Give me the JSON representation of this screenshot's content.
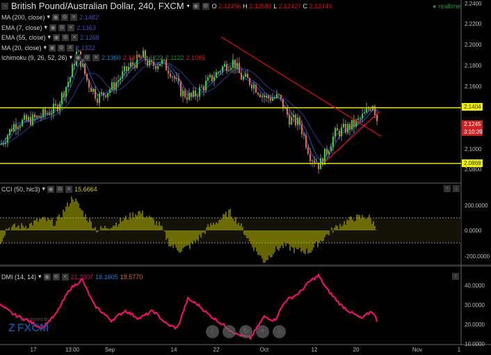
{
  "header": {
    "symbol": "British Pound/Australian Dollar, 240, FXCM",
    "o_label": "O",
    "o": "2.12456",
    "h_label": "H",
    "h": "2.12583",
    "l_label": "L",
    "l": "2.12427",
    "c_label": "C",
    "c": "2.12449",
    "status": "realtime"
  },
  "indicators": [
    {
      "label": "MA (200, close)",
      "value": "2.1482",
      "color": "#3040a0"
    },
    {
      "label": "EMA (7, close)",
      "value": "2.1363",
      "color": "#3050a0"
    },
    {
      "label": "EMA (55, close)",
      "value": "2.1268",
      "color": "#3050a0"
    },
    {
      "label": "MA (20, close)",
      "value": "2.1322",
      "color": "#3050a0"
    },
    {
      "label": "Ichimoku (9, 26, 52, 26)",
      "values": [
        "2.1360",
        "2.1371",
        "2.1222",
        "2.1122",
        "2.1085"
      ]
    }
  ],
  "price_axis": [
    "2.2400",
    "2.2200",
    "2.2000",
    "2.1800",
    "2.1600",
    "2.1000",
    "2.0800"
  ],
  "tags": {
    "resistance": "2.1404",
    "support": "2.0869",
    "last": "2.1245",
    "countdown": "3:10:39"
  },
  "cci": {
    "label": "CCI (50, hlc3)",
    "value": "15.6664",
    "axis": [
      "200.0000",
      "0.0000",
      "-200.0000"
    ]
  },
  "dmi": {
    "label": "DMI (14, 14)",
    "values": [
      "21.2007",
      "18.1605",
      "19.5770"
    ],
    "axis": [
      "40.0000",
      "30.0000",
      "20.0000",
      "10.0000"
    ]
  },
  "x_axis": [
    "17",
    "13:00",
    "Sep",
    "14",
    "22",
    "Oct",
    "12",
    "20",
    "Nov",
    "1"
  ],
  "sponsor": {
    "text": "Sponsored by",
    "brand": "FXCM"
  },
  "colors": {
    "up": "#22dd22",
    "down": "#e86840",
    "level": "#e0e000",
    "trend": "#e01010",
    "dmi": "#ff1070",
    "cci": "#c8c800"
  },
  "chart_data": [
    {
      "type": "candlestick",
      "title": "British Pound/Australian Dollar, 240, FXCM",
      "ylim": [
        2.08,
        2.24
      ],
      "close_path": [
        [
          0,
          2.105
        ],
        [
          20,
          2.125
        ],
        [
          50,
          2.13
        ],
        [
          80,
          2.14
        ],
        [
          100,
          2.17
        ],
        [
          110,
          2.195
        ],
        [
          125,
          2.165
        ],
        [
          140,
          2.15
        ],
        [
          160,
          2.16
        ],
        [
          185,
          2.18
        ],
        [
          205,
          2.19
        ],
        [
          215,
          2.18
        ],
        [
          230,
          2.185
        ],
        [
          245,
          2.175
        ],
        [
          260,
          2.155
        ],
        [
          275,
          2.15
        ],
        [
          290,
          2.16
        ],
        [
          305,
          2.17
        ],
        [
          320,
          2.18
        ],
        [
          335,
          2.185
        ],
        [
          345,
          2.17
        ],
        [
          360,
          2.165
        ],
        [
          380,
          2.15
        ],
        [
          400,
          2.15
        ],
        [
          415,
          2.13
        ],
        [
          430,
          2.125
        ],
        [
          445,
          2.095
        ],
        [
          458,
          2.085
        ],
        [
          470,
          2.1
        ],
        [
          480,
          2.115
        ],
        [
          495,
          2.12
        ],
        [
          510,
          2.125
        ],
        [
          525,
          2.135
        ],
        [
          535,
          2.145
        ],
        [
          543,
          2.1245
        ]
      ],
      "levels": [
        2.1404,
        2.0869
      ]
    },
    {
      "type": "bar",
      "title": "CCI (50, hlc3)",
      "ylim": [
        -300,
        300
      ],
      "path": [
        [
          0,
          -100
        ],
        [
          10,
          20
        ],
        [
          40,
          40
        ],
        [
          60,
          90
        ],
        [
          80,
          60
        ],
        [
          95,
          180
        ],
        [
          105,
          270
        ],
        [
          115,
          180
        ],
        [
          125,
          100
        ],
        [
          140,
          0
        ],
        [
          165,
          50
        ],
        [
          200,
          150
        ],
        [
          215,
          100
        ],
        [
          230,
          40
        ],
        [
          245,
          -120
        ],
        [
          260,
          -160
        ],
        [
          275,
          -120
        ],
        [
          290,
          -40
        ],
        [
          300,
          30
        ],
        [
          320,
          100
        ],
        [
          330,
          150
        ],
        [
          345,
          50
        ],
        [
          360,
          -100
        ],
        [
          380,
          -250
        ],
        [
          395,
          -160
        ],
        [
          410,
          -120
        ],
        [
          425,
          -160
        ],
        [
          445,
          -170
        ],
        [
          460,
          -90
        ],
        [
          475,
          -10
        ],
        [
          490,
          50
        ],
        [
          510,
          100
        ],
        [
          530,
          110
        ],
        [
          543,
          15.6664
        ]
      ]
    },
    {
      "type": "line",
      "title": "DMI (14, 14)",
      "ylim": [
        10,
        48
      ],
      "path": [
        [
          0,
          30
        ],
        [
          20,
          25
        ],
        [
          40,
          22
        ],
        [
          60,
          18
        ],
        [
          80,
          25
        ],
        [
          100,
          38
        ],
        [
          118,
          43
        ],
        [
          135,
          30
        ],
        [
          160,
          22
        ],
        [
          180,
          27
        ],
        [
          200,
          23
        ],
        [
          220,
          27
        ],
        [
          240,
          20
        ],
        [
          255,
          18
        ],
        [
          270,
          33
        ],
        [
          285,
          30
        ],
        [
          300,
          25
        ],
        [
          320,
          20
        ],
        [
          340,
          15
        ],
        [
          360,
          13
        ],
        [
          380,
          24
        ],
        [
          395,
          22
        ],
        [
          410,
          32
        ],
        [
          430,
          36
        ],
        [
          445,
          42
        ],
        [
          458,
          45
        ],
        [
          470,
          38
        ],
        [
          490,
          30
        ],
        [
          505,
          26
        ],
        [
          520,
          23
        ],
        [
          535,
          27
        ],
        [
          543,
          21.2007
        ]
      ]
    }
  ]
}
